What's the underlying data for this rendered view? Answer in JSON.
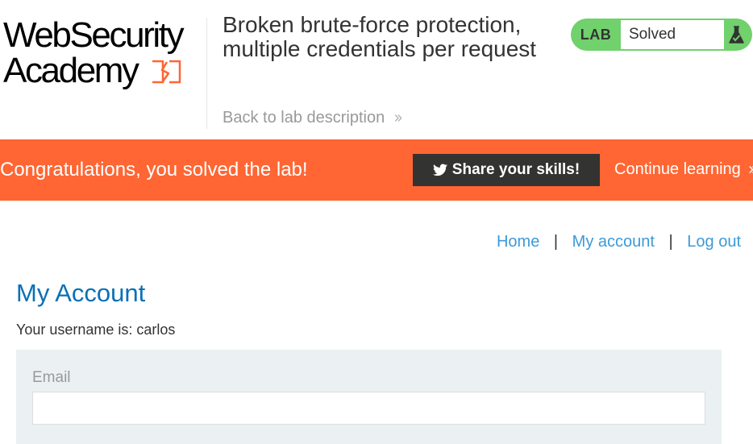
{
  "header": {
    "logo": {
      "line1": "WebSecurity",
      "line2": "Academy"
    },
    "lab_title": "Broken brute-force protection, multiple credentials per request",
    "back_link": "Back to lab description",
    "lab_status": {
      "tag": "LAB",
      "state": "Solved",
      "status_color": "#70d16d",
      "icon": "flask-icon"
    }
  },
  "banner": {
    "message": "Congratulations, you solved the lab!",
    "share_button": "Share your skills!",
    "continue_link": "Continue learning",
    "background_color": "#ff6633",
    "icons": [
      "twitter-icon",
      "chevron-double-right-icon"
    ]
  },
  "nav": {
    "home": "Home",
    "sep1": "|",
    "my_account": "My account",
    "sep2": "|",
    "log_out": "Log out",
    "link_color": "#3c9ad8"
  },
  "main": {
    "title": "My Account",
    "username_line": "Your username is: carlos",
    "email_form": {
      "label": "Email",
      "value": "",
      "placeholder": ""
    },
    "title_color": "#0a70b6"
  }
}
